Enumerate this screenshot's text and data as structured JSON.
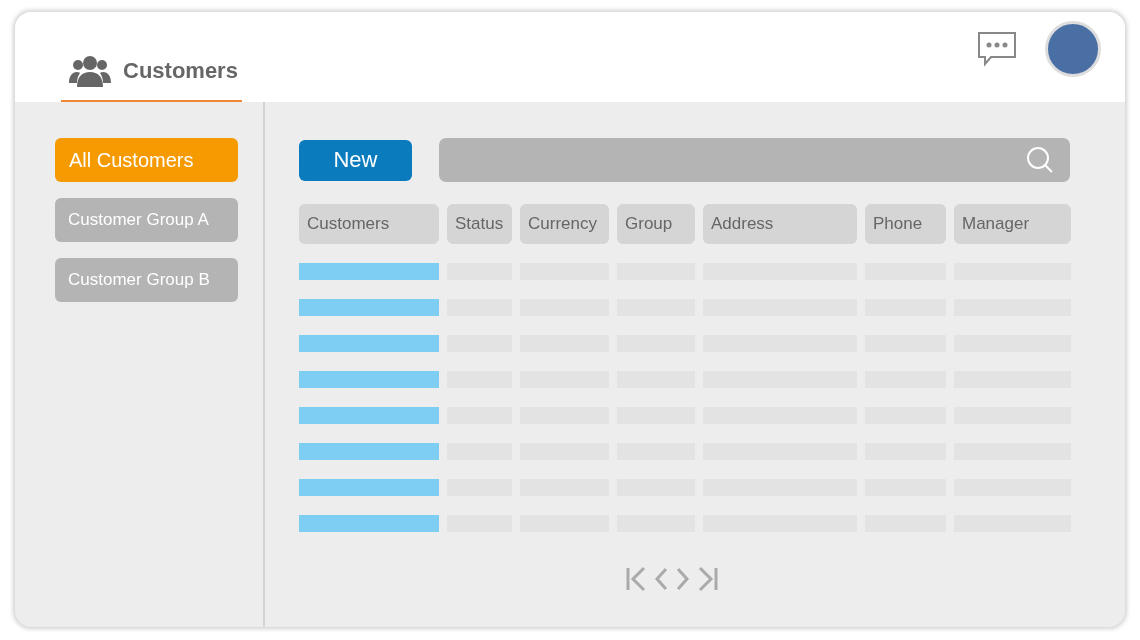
{
  "header": {
    "tabs": [
      {
        "label": "Customers",
        "selected": true
      }
    ]
  },
  "sidebar": {
    "items": [
      {
        "label": "All Customers",
        "selected": true
      },
      {
        "label": "Customer Group A",
        "selected": false
      },
      {
        "label": "Customer Group B",
        "selected": false
      }
    ]
  },
  "toolbar": {
    "new_button": "New"
  },
  "table": {
    "columns": [
      "Customers",
      "Status",
      "Currency",
      "Group",
      "Address",
      "Phone",
      "Manager"
    ],
    "rows": [
      {
        "kind": "placeholder"
      },
      {
        "kind": "placeholder"
      },
      {
        "kind": "placeholder"
      },
      {
        "kind": "placeholder"
      },
      {
        "kind": "placeholder"
      },
      {
        "kind": "placeholder"
      },
      {
        "kind": "placeholder"
      },
      {
        "kind": "placeholder"
      }
    ]
  }
}
